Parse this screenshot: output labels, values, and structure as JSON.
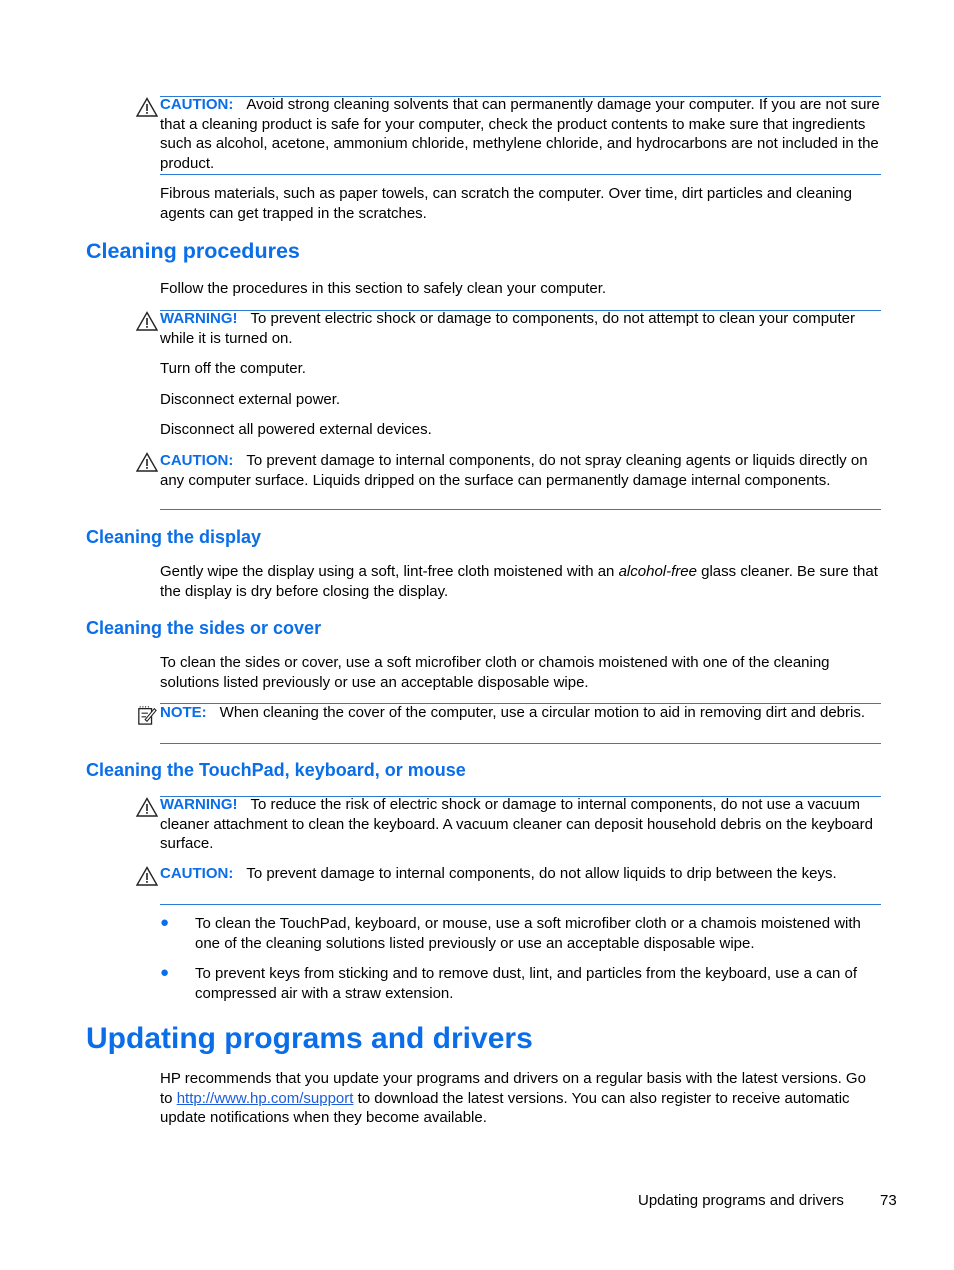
{
  "caution_label": "CAUTION:",
  "warning_label": "WARNING!",
  "note_label": "NOTE:",
  "intro": {
    "caution1": "Avoid strong cleaning solvents that can permanently damage your computer. If you are not sure that a cleaning product is safe for your computer, check the product contents to make sure that ingredients such as alcohol, acetone, ammonium chloride, methylene chloride, and hydrocarbons are not included in the product.",
    "fibrous": "Fibrous materials, such as paper towels, can scratch the computer. Over time, dirt particles and cleaning agents can get trapped in the scratches."
  },
  "cleaning_procedures": {
    "heading": "Cleaning procedures",
    "intro": "Follow the procedures in this section to safely clean your computer.",
    "warning": "To prevent electric shock or damage to components, do not attempt to clean your computer while it is turned on.",
    "steps": [
      "Turn off the computer.",
      "Disconnect external power.",
      "Disconnect all powered external devices."
    ],
    "caution": "To prevent damage to internal components, do not spray cleaning agents or liquids directly on any computer surface. Liquids dripped on the surface can permanently damage internal components."
  },
  "cleaning_display": {
    "heading": "Cleaning the display",
    "text_before": "Gently wipe the display using a soft, lint-free cloth moistened with an ",
    "text_italic": "alcohol-free",
    "text_after": " glass cleaner. Be sure that the display is dry before closing the display."
  },
  "cleaning_sides": {
    "heading": "Cleaning the sides or cover",
    "text": "To clean the sides or cover, use a soft microfiber cloth or chamois moistened with one of the cleaning solutions listed previously or use an acceptable disposable wipe.",
    "note": "When cleaning the cover of the computer, use a circular motion to aid in removing dirt and debris."
  },
  "cleaning_touchpad": {
    "heading": "Cleaning the TouchPad, keyboard, or mouse",
    "warning": "To reduce the risk of electric shock or damage to internal components, do not use a vacuum cleaner attachment to clean the keyboard. A vacuum cleaner can deposit household debris on the keyboard surface.",
    "caution": "To prevent damage to internal components, do not allow liquids to drip between the keys.",
    "bullets": [
      "To clean the TouchPad, keyboard, or mouse, use a soft microfiber cloth or a chamois moistened with one of the cleaning solutions listed previously or use an acceptable disposable wipe.",
      "To prevent keys from sticking and to remove dust, lint, and particles from the keyboard, use a can of compressed air with a straw extension."
    ]
  },
  "updating": {
    "heading": "Updating programs and drivers",
    "text_before": "HP recommends that you update your programs and drivers on a regular basis with the latest versions. Go to ",
    "link": "http://www.hp.com/support",
    "text_after": " to download the latest versions. You can also register to receive automatic update notifications when they become available."
  },
  "footer": {
    "section": "Updating programs and drivers",
    "page_number": "73"
  },
  "colors": {
    "accent": "#0a6ee8",
    "rule": "#2b7ad6",
    "link": "#1a5ce0"
  }
}
